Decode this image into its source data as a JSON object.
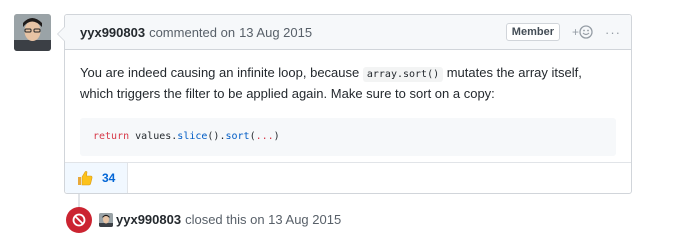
{
  "comment": {
    "author": "yyx990803",
    "action": "commented on",
    "date": "13 Aug 2015",
    "badge": "Member",
    "body_part1": "You are indeed causing an infinite loop, because ",
    "inline_code": "array.sort()",
    "body_part2": " mutates the array itself, which triggers the filter to be applied again. Make sure to sort on a copy:",
    "code": {
      "keyword": "return",
      "text1": " values.",
      "fn1": "slice",
      "text2": "().",
      "fn2": "sort",
      "text3": "(",
      "dots": "...",
      "text4": ")"
    }
  },
  "reactions": [
    {
      "icon": "thumbs-up-icon",
      "count": "34"
    }
  ],
  "event": {
    "actor": "yyx990803",
    "text": "closed this on 13 Aug 2015"
  },
  "colors": {
    "closed": "#cb2431",
    "link": "#0366d6"
  }
}
